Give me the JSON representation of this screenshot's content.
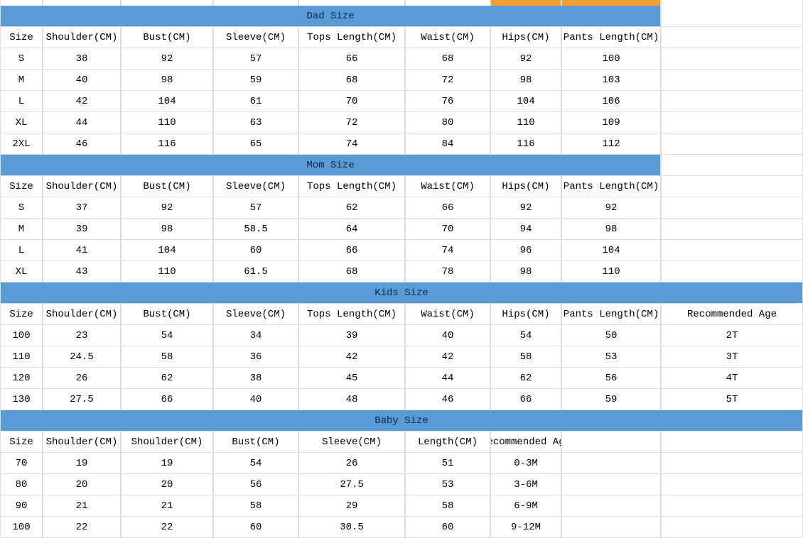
{
  "sections": {
    "dad": {
      "title": "Dad Size",
      "headers": [
        "Size",
        "Shoulder(CM)",
        "Bust(CM)",
        "Sleeve(CM)",
        "Tops Length(CM)",
        "Waist(CM)",
        "Hips(CM)",
        "Pants Length(CM)"
      ],
      "rows": [
        [
          "S",
          "38",
          "92",
          "57",
          "66",
          "68",
          "92",
          "100"
        ],
        [
          "M",
          "40",
          "98",
          "59",
          "68",
          "72",
          "98",
          "103"
        ],
        [
          "L",
          "42",
          "104",
          "61",
          "70",
          "76",
          "104",
          "106"
        ],
        [
          "XL",
          "44",
          "110",
          "63",
          "72",
          "80",
          "110",
          "109"
        ],
        [
          "2XL",
          "46",
          "116",
          "65",
          "74",
          "84",
          "116",
          "112"
        ]
      ]
    },
    "mom": {
      "title": "Mom Size",
      "headers": [
        "Size",
        "Shoulder(CM)",
        "Bust(CM)",
        "Sleeve(CM)",
        "Tops Length(CM)",
        "Waist(CM)",
        "Hips(CM)",
        "Pants Length(CM)"
      ],
      "rows": [
        [
          "S",
          "37",
          "92",
          "57",
          "62",
          "66",
          "92",
          "92"
        ],
        [
          "M",
          "39",
          "98",
          "58.5",
          "64",
          "70",
          "94",
          "98"
        ],
        [
          "L",
          "41",
          "104",
          "60",
          "66",
          "74",
          "96",
          "104"
        ],
        [
          "XL",
          "43",
          "110",
          "61.5",
          "68",
          "78",
          "98",
          "110"
        ]
      ]
    },
    "kids": {
      "title": "Kids Size",
      "headers": [
        "Size",
        "Shoulder(CM)",
        "Bust(CM)",
        "Sleeve(CM)",
        "Tops Length(CM)",
        "Waist(CM)",
        "Hips(CM)",
        "Pants Length(CM)",
        "Recommended Age"
      ],
      "rows": [
        [
          "100",
          "23",
          "54",
          "34",
          "39",
          "40",
          "54",
          "50",
          "2T"
        ],
        [
          "110",
          "24.5",
          "58",
          "36",
          "42",
          "42",
          "58",
          "53",
          "3T"
        ],
        [
          "120",
          "26",
          "62",
          "38",
          "45",
          "44",
          "62",
          "56",
          "4T"
        ],
        [
          "130",
          "27.5",
          "66",
          "40",
          "48",
          "46",
          "66",
          "59",
          "5T"
        ]
      ]
    },
    "baby": {
      "title": "Baby Size",
      "headers": [
        "Size",
        "Shoulder(CM)",
        "Shoulder(CM)",
        "Bust(CM)",
        "Sleeve(CM)",
        "Length(CM)",
        "Recommended Age"
      ],
      "rows": [
        [
          "70",
          "19",
          "19",
          "54",
          "26",
          "51",
          "0-3M"
        ],
        [
          "80",
          "20",
          "20",
          "56",
          "27.5",
          "53",
          "3-6M"
        ],
        [
          "90",
          "21",
          "21",
          "58",
          "29",
          "58",
          "6-9M"
        ],
        [
          "100",
          "22",
          "22",
          "60",
          "30.5",
          "60",
          "9-12M"
        ]
      ]
    }
  },
  "colors": {
    "band": "#5b9bd5",
    "highlight": "#f0a030"
  }
}
